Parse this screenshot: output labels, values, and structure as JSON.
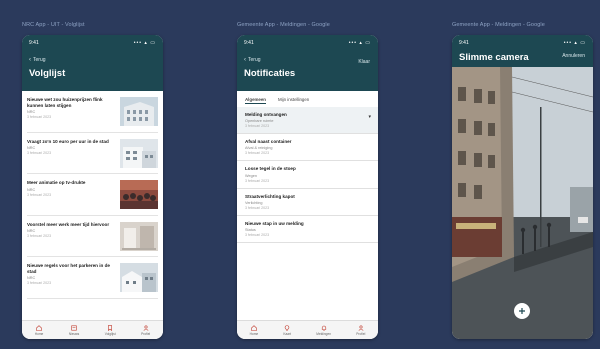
{
  "captions": {
    "left": "NRC App - UIT - Volglijst",
    "middle": "Gemeente App - Meldingen - Google",
    "right": "Gemeente App - Meldingen - Google"
  },
  "phone1": {
    "time": "9:41",
    "signal": "••• ▴ ▭",
    "back_label": "Terug",
    "title": "Volglijst",
    "articles": [
      {
        "headline": "Nieuwe wet zou huizenprijzen flink kunnen laten stijgen",
        "source": "NRC",
        "date": "3 februari 2023"
      },
      {
        "headline": "Vraagt zo'n 10 euro per uur in de stad",
        "source": "NRC",
        "date": "3 februari 2023"
      },
      {
        "headline": "Meer animatie op tv-drukte",
        "source": "NRC",
        "date": "3 februari 2023"
      },
      {
        "headline": "Voorstel meer werk meer tijd hiervoor",
        "source": "NRC",
        "date": "3 februari 2023"
      },
      {
        "headline": "Nieuwe regels voor het parkeren in de stad",
        "source": "NRC",
        "date": "3 februari 2023"
      }
    ],
    "nav": [
      "Home",
      "Nieuws",
      "Volglijst",
      "Profiel"
    ]
  },
  "phone2": {
    "time": "9:41",
    "signal": "••• ▴ ▭",
    "back_label": "Terug",
    "right_link": "Klaar",
    "title": "Notificaties",
    "tabs": [
      "Algemeen",
      "Mijn instellingen"
    ],
    "notifications": [
      {
        "title": "Melding ontvangen",
        "subtitle": "Openbare ruimte",
        "date": "3 februari 2023"
      },
      {
        "title": "Afval naast container",
        "subtitle": "Afval & reiniging",
        "date": "3 februari 2023"
      },
      {
        "title": "Losse tegel in de stoep",
        "subtitle": "Wegen",
        "date": "3 februari 2023"
      },
      {
        "title": "Straatverlichting kapot",
        "subtitle": "Verlichting",
        "date": "3 februari 2023"
      },
      {
        "title": "Nieuwe stap in uw melding",
        "subtitle": "Status",
        "date": "3 februari 2023"
      }
    ],
    "nav": [
      "Home",
      "Kaart",
      "Meldingen",
      "Profiel"
    ]
  },
  "phone3": {
    "time": "9:41",
    "signal": "••• ▴ ▭",
    "title": "Slimme camera",
    "right_link": "Annuleren"
  },
  "colors": {
    "background": "#2b3a5c",
    "header": "#1d4852",
    "nav_accent": "#c0392b"
  }
}
